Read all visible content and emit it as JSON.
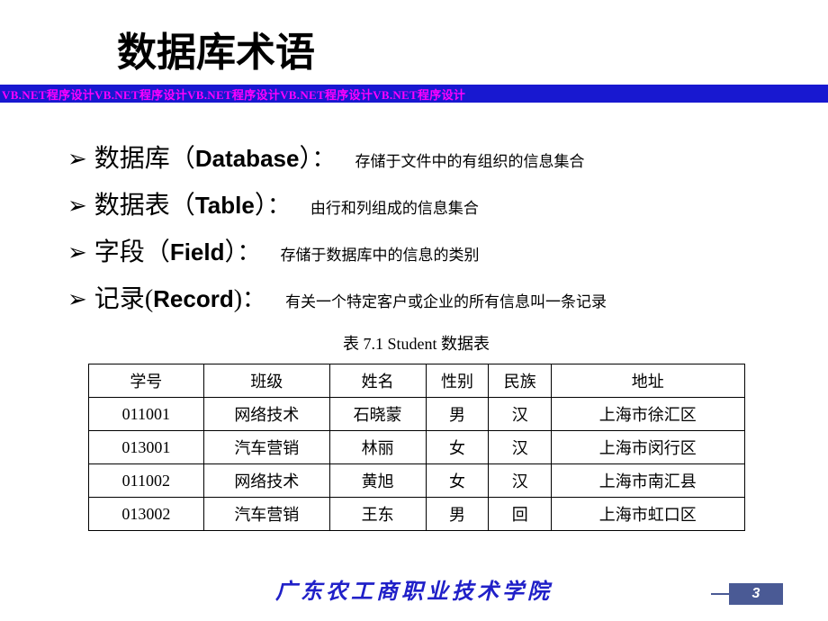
{
  "title": "数据库术语",
  "banner_text": "VB.NET程序设计VB.NET程序设计VB.NET程序设计VB.NET程序设计VB.NET程序设计",
  "bullets": [
    {
      "term_cn": "数据库",
      "paren_open": "（",
      "term_en": "Database",
      "paren_close": "）",
      "colon": "：",
      "desc": "存储于文件中的有组织的信息集合"
    },
    {
      "term_cn": "数据表",
      "paren_open": "（",
      "term_en": "Table",
      "paren_close": "）",
      "colon": "：",
      "desc": "由行和列组成的信息集合"
    },
    {
      "term_cn": "字段",
      "paren_open": "（",
      "term_en": "Field",
      "paren_close": "）",
      "colon": "：",
      "desc": "存储于数据库中的信息的类别"
    },
    {
      "term_cn": "记录",
      "paren_open": "(",
      "term_en": "Record",
      "paren_close": ")",
      "colon": "：",
      "desc": "有关一个特定客户或企业的所有信息叫一条记录"
    }
  ],
  "table": {
    "caption": "表 7.1   Student 数据表",
    "headers": [
      "学号",
      "班级",
      "姓名",
      "性别",
      "民族",
      "地址"
    ],
    "rows": [
      [
        "011001",
        "网络技术",
        "石晓蒙",
        "男",
        "汉",
        "上海市徐汇区"
      ],
      [
        "013001",
        "汽车营销",
        "林丽",
        "女",
        "汉",
        "上海市闵行区"
      ],
      [
        "011002",
        "网络技术",
        "黄旭",
        "女",
        "汉",
        "上海市南汇县"
      ],
      [
        "013002",
        "汽车营销",
        "王东",
        "男",
        "回",
        "上海市虹口区"
      ]
    ]
  },
  "footer": {
    "institution": "广东农工商职业技术学院",
    "page_number": "3"
  }
}
